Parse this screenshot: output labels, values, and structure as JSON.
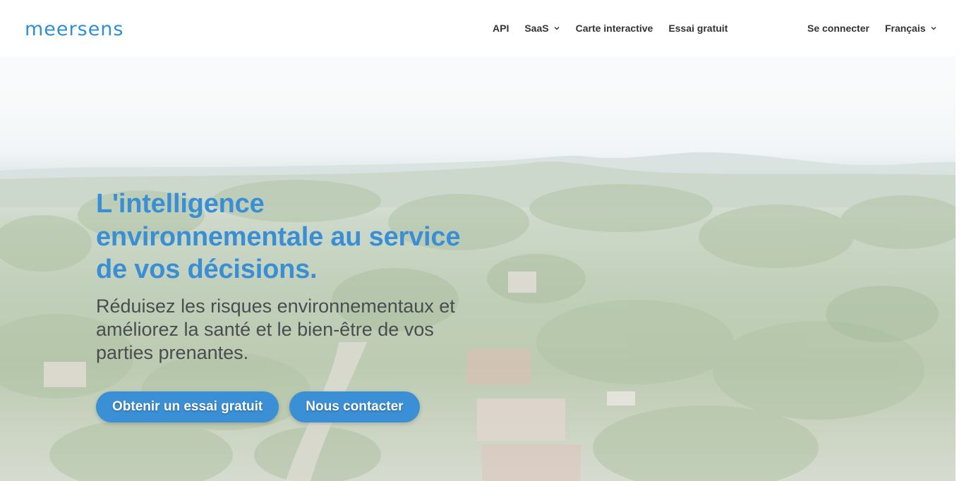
{
  "brand": {
    "logo_text": "meersens",
    "accent_color": "#3b8fd5"
  },
  "nav": {
    "items": [
      {
        "label": "API",
        "has_dropdown": false
      },
      {
        "label": "SaaS",
        "has_dropdown": true,
        "icon": "chevron-down-icon"
      },
      {
        "label": "Carte interactive",
        "has_dropdown": false
      },
      {
        "label": "Essai gratuit",
        "has_dropdown": false
      }
    ],
    "login_label": "Se connecter",
    "language_label": "Français",
    "language_icon": "chevron-down-icon"
  },
  "hero": {
    "title": "L'intelligence environnementale au service de vos décisions.",
    "subtitle": "Réduisez les risques environnementaux et améliorez la santé et le bien-être de vos parties prenantes.",
    "primary_cta": "Obtenir un essai gratuit",
    "secondary_cta": "Nous contacter",
    "background": "aerial-forest-town-image"
  }
}
